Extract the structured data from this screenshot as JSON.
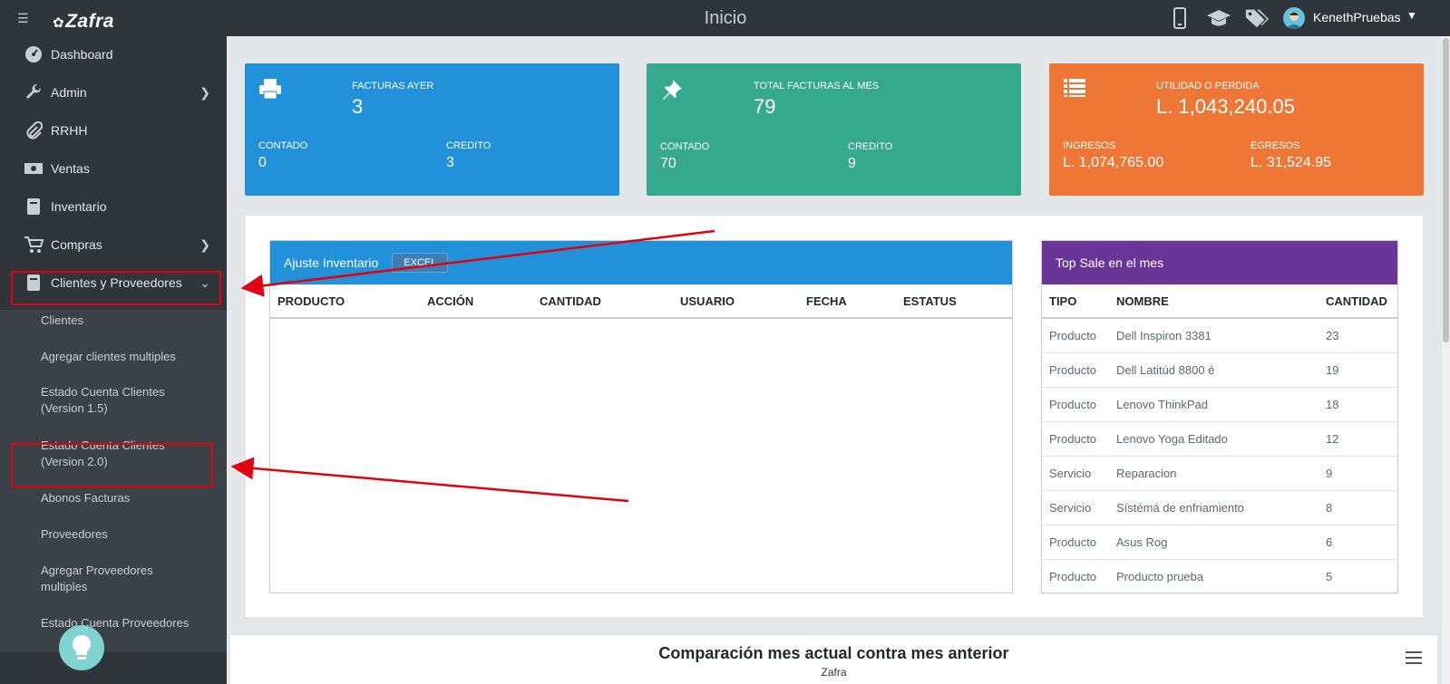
{
  "header": {
    "brand": "Zafra",
    "page_title": "Inicio",
    "username": "KenethPruebas"
  },
  "sidebar": {
    "items": [
      {
        "label": "Dashboard",
        "icon": "dashboard-icon"
      },
      {
        "label": "Admin",
        "icon": "wrench-icon"
      },
      {
        "label": "RRHH",
        "icon": "paperclip-icon"
      },
      {
        "label": "Ventas",
        "icon": "money-icon"
      },
      {
        "label": "Inventario",
        "icon": "book-icon"
      },
      {
        "label": "Compras",
        "icon": "cart-icon"
      },
      {
        "label": "Clientes y Proveedores",
        "icon": "book-icon"
      }
    ],
    "submenu": [
      "Clientes",
      "Agregar clientes multiples",
      "Estado Cuenta Clientes (Version 1.5)",
      "Estado Cuenta Clientes (Version 2.0)",
      "Abonos Facturas",
      "Proveedores",
      "Agregar Proveedores multiples",
      "Estado Cuenta Proveedores"
    ]
  },
  "cards": {
    "yesterday": {
      "label": "FACTURAS AYER",
      "value": "3",
      "left_label": "CONTADO",
      "left_value": "0",
      "right_label": "CREDITO",
      "right_value": "3"
    },
    "month": {
      "label": "TOTAL FACTURAS AL MES",
      "value": "79",
      "left_label": "CONTADO",
      "left_value": "70",
      "right_label": "CREDITO",
      "right_value": "9"
    },
    "profit": {
      "label": "UTILIDAD O PERDIDA",
      "value": "L. 1,043,240.05",
      "left_label": "INGRESOS",
      "left_value": "L. 1,074,765.00",
      "right_label": "EGRESOS",
      "right_value": "L. 31,524.95"
    }
  },
  "inventory": {
    "title": "Ajuste Inventario",
    "excel_label": "EXCEL",
    "columns": [
      "PRODUCTO",
      "ACCIÓN",
      "CANTIDAD",
      "USUARIO",
      "FECHA",
      "ESTATUS"
    ]
  },
  "top_sale": {
    "title": "Top Sale en el mes",
    "columns": [
      "TIPO",
      "NOMBRE",
      "CANTIDAD"
    ],
    "rows": [
      [
        "Producto",
        "Dell Inspiron 3381",
        "23"
      ],
      [
        "Producto",
        "Dell Latitúd 8800 é",
        "19"
      ],
      [
        "Producto",
        "Lenovo ThinkPad",
        "18"
      ],
      [
        "Producto",
        "Lenovo Yoga Editado",
        "12"
      ],
      [
        "Servicio",
        "Reparacion",
        "9"
      ],
      [
        "Servicio",
        "Sístémá de enfriamiento",
        "8"
      ],
      [
        "Producto",
        "Asus Rog",
        "6"
      ],
      [
        "Producto",
        "Producto prueba",
        "5"
      ]
    ]
  },
  "chart": {
    "title": "Comparación mes actual contra mes anterior",
    "subtitle": "Zafra"
  },
  "colors": {
    "topbar": "#2f353a",
    "blue": "#2191d9",
    "green": "#35a98c",
    "orange": "#ee7736",
    "purple": "#6a3599",
    "annotation_red": "#e3000f"
  }
}
